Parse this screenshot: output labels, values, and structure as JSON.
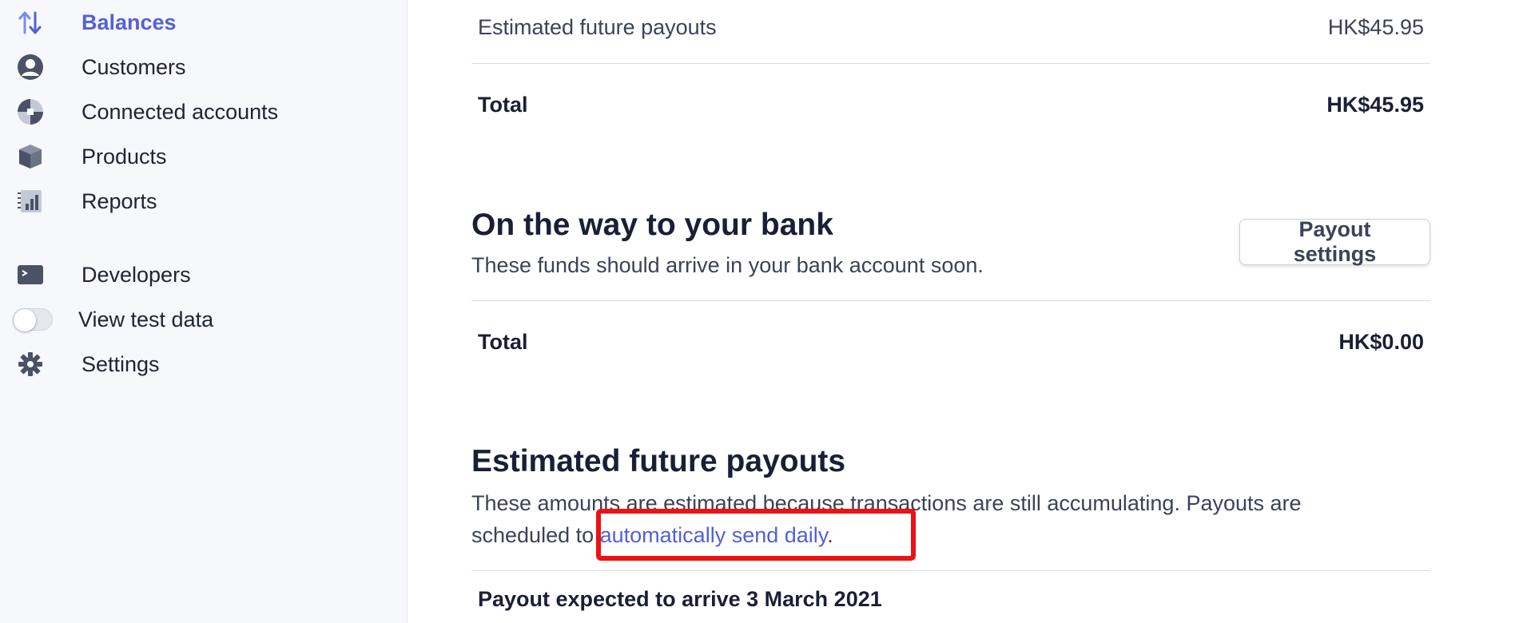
{
  "sidebar": {
    "items": [
      {
        "label": "Balances",
        "icon": "arrows-up-down-icon"
      },
      {
        "label": "Customers",
        "icon": "user-circle-icon"
      },
      {
        "label": "Connected accounts",
        "icon": "connect-icon"
      },
      {
        "label": "Products",
        "icon": "box-icon"
      },
      {
        "label": "Reports",
        "icon": "chart-icon"
      },
      {
        "label": "Developers",
        "icon": "terminal-icon"
      },
      {
        "label": "View test data",
        "icon": "toggle"
      },
      {
        "label": "Settings",
        "icon": "gear-icon"
      }
    ]
  },
  "summary": {
    "future_payouts_label": "Estimated future payouts",
    "future_payouts_value": "HK$45.95",
    "total_label": "Total",
    "total_value": "HK$45.95"
  },
  "on_the_way": {
    "title": "On the way to your bank",
    "description": "These funds should arrive in your bank account soon.",
    "button_label": "Payout settings",
    "total_label": "Total",
    "total_value": "HK$0.00"
  },
  "future": {
    "title": "Estimated future payouts",
    "description_line1": "These amounts are estimated because transactions are still accumulating. Payouts are",
    "description_line2_prefix": "scheduled to ",
    "link_text": "automatically send daily",
    "description_line2_suffix": ".",
    "payout_row": "Payout expected to arrive 3 March 2021"
  },
  "colors": {
    "accent": "#5261d6",
    "highlight": "#ee1111"
  }
}
